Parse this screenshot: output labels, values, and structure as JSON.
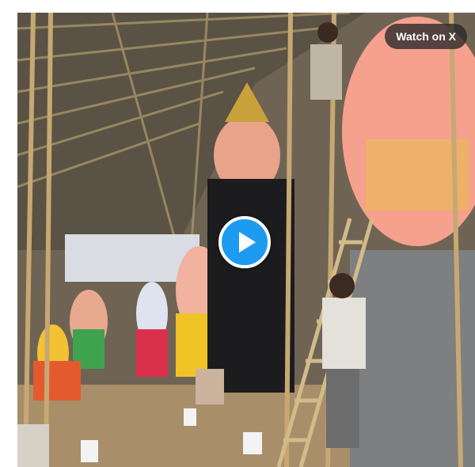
{
  "post": {
    "watch_label": "Watch on X"
  },
  "video": {
    "description_icon": "play-icon",
    "accent_color": "#1d9bf0"
  }
}
